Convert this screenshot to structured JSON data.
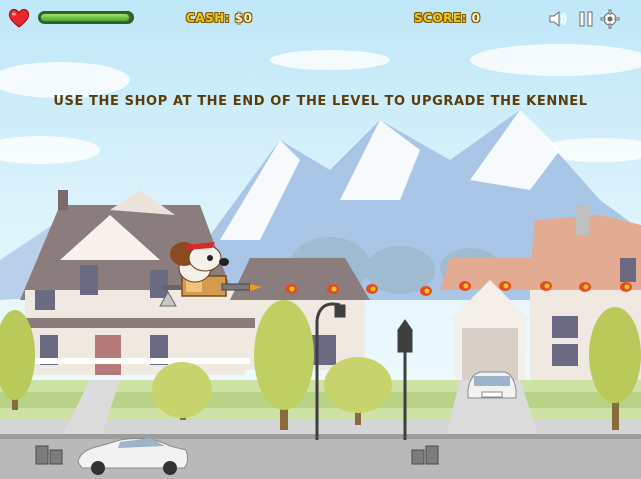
{
  "hud": {
    "cash_label": "CASH:",
    "cash_value": "$0",
    "score_label": "SCORE:",
    "score_value": "0",
    "health_level": 0.98,
    "icons": [
      "heart-icon",
      "sound-icon",
      "pause-icon",
      "settings-icon"
    ]
  },
  "message": {
    "text": "USE THE SHOP AT THE END OF THE LEVEL TO UPGRADE THE KENNEL"
  },
  "colors": {
    "hud_text": "#f3c51c",
    "hint_text": "#5a3d0a",
    "health_fill": "#5fc23a",
    "heart": "#e8262c"
  }
}
